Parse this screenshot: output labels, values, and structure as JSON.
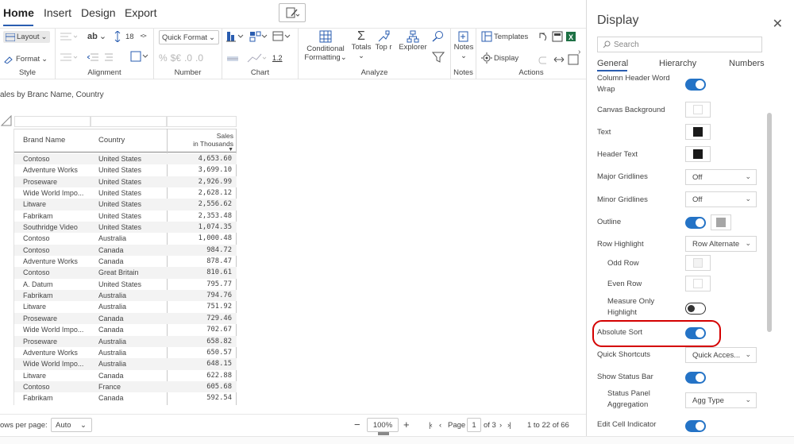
{
  "tabs": [
    "Home",
    "Insert",
    "Design",
    "Export"
  ],
  "ribbon": {
    "layout_label": "Layout",
    "format_label": "Format",
    "style_label": "Style",
    "font_size": "18",
    "alignment_label": "Alignment",
    "quick_format": "Quick Format",
    "number_label": "Number",
    "dec_label": "1.2",
    "chart_label": "Chart",
    "conditional_label": "Conditional",
    "formatting_label": "Formatting",
    "totals_label": "Totals",
    "topn_label": "Top r",
    "explorer_label": "Explorer",
    "analyze_label": "Analyze",
    "notes_label": "Notes",
    "notes_group_label": "Notes",
    "templates_label": "Templates",
    "display_label": "Display",
    "actions_label": "Actions"
  },
  "report": {
    "subtitle": "ales by Branc Name, Country",
    "columns": [
      "Brand Name",
      "Country",
      "Sales",
      "in Thousands"
    ],
    "rows": [
      [
        "Contoso",
        "United States",
        "4,653.60"
      ],
      [
        "Adventure Works",
        "United States",
        "3,699.10"
      ],
      [
        "Proseware",
        "United States",
        "2,926.99"
      ],
      [
        "Wide World Impo...",
        "United States",
        "2,628.12"
      ],
      [
        "Litware",
        "United States",
        "2,556.62"
      ],
      [
        "Fabrikam",
        "United States",
        "2,353.48"
      ],
      [
        "Southridge Video",
        "United States",
        "1,074.35"
      ],
      [
        "Contoso",
        "Australia",
        "1,000.48"
      ],
      [
        "Contoso",
        "Canada",
        "984.72"
      ],
      [
        "Adventure Works",
        "Canada",
        "878.47"
      ],
      [
        "Contoso",
        "Great Britain",
        "810.61"
      ],
      [
        "A. Datum",
        "United States",
        "795.77"
      ],
      [
        "Fabrikam",
        "Australia",
        "794.76"
      ],
      [
        "Litware",
        "Australia",
        "751.92"
      ],
      [
        "Proseware",
        "Canada",
        "729.46"
      ],
      [
        "Wide World Impo...",
        "Canada",
        "702.67"
      ],
      [
        "Proseware",
        "Australia",
        "658.82"
      ],
      [
        "Adventure Works",
        "Australia",
        "650.57"
      ],
      [
        "Wide World Impo...",
        "Australia",
        "648.15"
      ],
      [
        "Litware",
        "Canada",
        "622.88"
      ],
      [
        "Contoso",
        "France",
        "605.68"
      ],
      [
        "Fabrikam",
        "Canada",
        "592.54"
      ]
    ]
  },
  "statusbar": {
    "rows_per_page_label": "ows per page:",
    "rows_per_page_value": "Auto",
    "zoom": "100%",
    "page_label": "Page",
    "page_value": "1",
    "of_pages": "of 3",
    "range": "1  to 22 of 66"
  },
  "panel": {
    "title": "Display",
    "search_placeholder": "Search",
    "tabs": [
      "General",
      "Hierarchy",
      "Numbers"
    ],
    "items": {
      "col_header_wrap": "Column Header Word Wrap",
      "canvas_bg": "Canvas Background",
      "text": "Text",
      "header_text": "Header Text",
      "major_grid": "Major Gridlines",
      "major_grid_value": "Off",
      "minor_grid": "Minor Gridlines",
      "minor_grid_value": "Off",
      "outline": "Outline",
      "row_highlight": "Row Highlight",
      "row_highlight_value": "Row Alternate",
      "odd_row": "Odd Row",
      "even_row": "Even Row",
      "measure_only": "Measure Only Highlight",
      "absolute_sort": "Absolute Sort",
      "quick_shortcuts": "Quick Shortcuts",
      "quick_shortcuts_value": "Quick Acces...",
      "show_status_bar": "Show Status Bar",
      "status_panel_agg": "Status Panel Aggregation",
      "status_panel_agg_value": "Agg Type",
      "edit_cell": "Edit Cell Indicator"
    }
  },
  "colors": {
    "accent": "#2473c6",
    "highlight_ring": "#d40000"
  }
}
